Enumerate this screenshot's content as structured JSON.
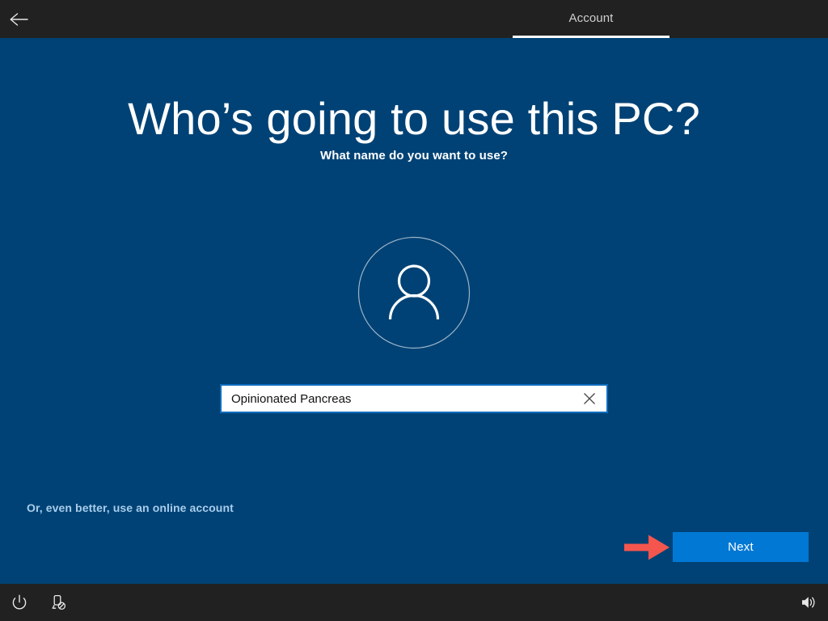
{
  "window": {
    "title_bar": {
      "back_label": "Back",
      "back_icon": "arrow-left-icon",
      "tab_label": "Account"
    }
  },
  "page": {
    "heading": "Who’s going to use this PC?",
    "subheading": "What name do you want to use?",
    "avatar_icon": "person-outline-icon"
  },
  "form": {
    "name_input": {
      "value": "Opinionated Pancreas",
      "placeholder": "",
      "clear_icon": "close-x-icon"
    }
  },
  "footer": {
    "online_account_link": "Or, even better, use an online account",
    "next_label": "Next",
    "pointer_icon": "arrow-right-annotation"
  },
  "taskbar": {
    "items": [
      {
        "name": "power-icon",
        "label": "Power"
      },
      {
        "name": "ease-of-access-icon",
        "label": "Ease of Access"
      },
      {
        "name": "volume-icon",
        "label": "Volume"
      }
    ]
  },
  "colors": {
    "background_blue": "#004275",
    "taskbar_dark": "#212121",
    "accent_blue": "#0078d4",
    "input_border": "#0f6cbd",
    "link_blue": "#a8cdec",
    "annotation_red": "#f4564e",
    "tab_text": "#cfcfcf"
  }
}
